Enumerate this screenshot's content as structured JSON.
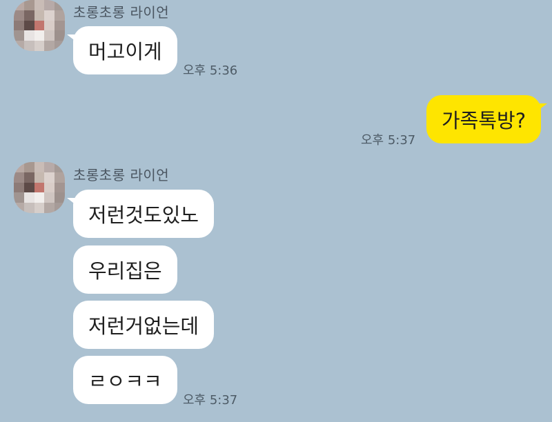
{
  "messages": [
    {
      "sender": "초롱초롱 라이언",
      "bubbles": [
        "머고이게"
      ],
      "time": "오후 5:36"
    },
    {
      "sender": "me",
      "bubbles": [
        "가족톡방?"
      ],
      "time": "오후 5:37"
    },
    {
      "sender": "초롱초롱 라이언",
      "bubbles": [
        "저런것도있노",
        "우리집은",
        "저런거없는데",
        "ㄹㅇㅋㅋ"
      ],
      "time": "오후 5:37"
    }
  ],
  "colors": {
    "background": "#abc1d1",
    "incoming_bubble": "#ffffff",
    "outgoing_bubble": "#fee500"
  }
}
